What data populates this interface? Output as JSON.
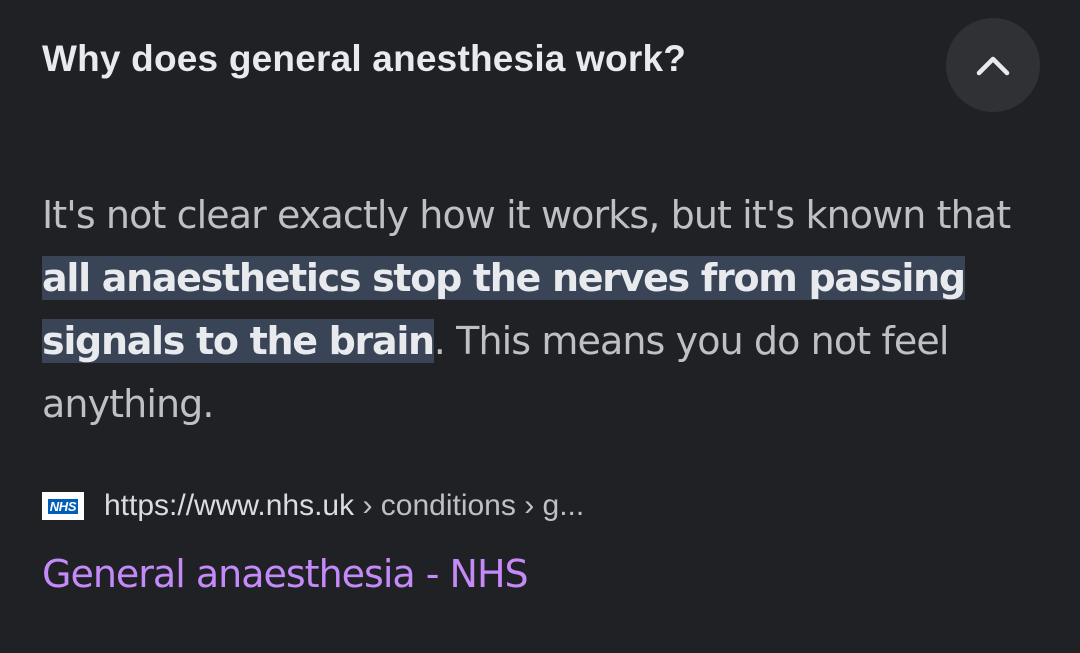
{
  "question": "Why does general anesthesia work?",
  "collapse_icon": "chevron-up-icon",
  "answer": {
    "before_highlight": "It's not clear exactly how it works, but it's known that ",
    "highlight_line1": "all anaesthetics stop the nerves from passing",
    "highlight_line2": "signals to the brain",
    "after_highlight": ". This means you do not feel anything."
  },
  "source": {
    "logo_text": "NHS",
    "url_host": "https://www.nhs.uk",
    "url_path": " › conditions › g...",
    "title": "General anaesthesia - NHS"
  },
  "colors": {
    "background": "#202124",
    "highlight": "#394457",
    "link": "#c58af9",
    "nhs_blue": "#005eb8"
  }
}
